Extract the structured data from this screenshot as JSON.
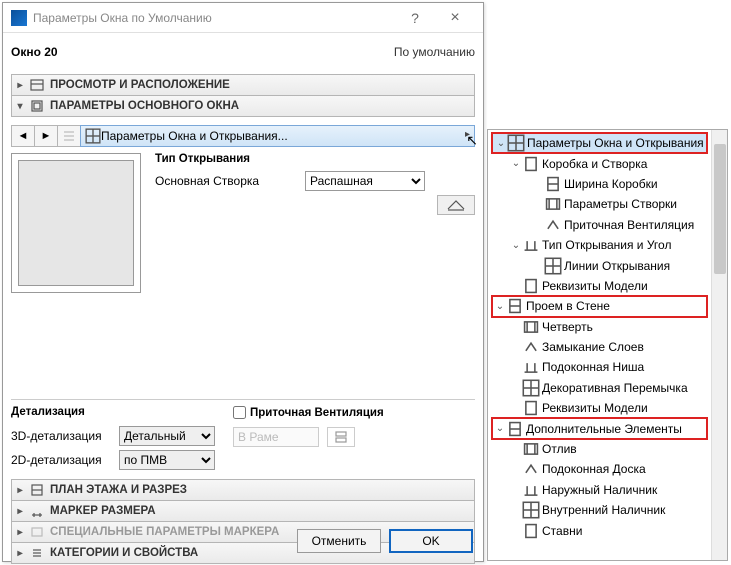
{
  "titlebar": {
    "title": "Параметры Окна по Умолчанию"
  },
  "subheader": {
    "left": "Окно 20",
    "right": "По умолчанию"
  },
  "top_panels": [
    {
      "label": "ПРОСМОТР И РАСПОЛОЖЕНИЕ",
      "expanded": false
    },
    {
      "label": "ПАРАМЕТРЫ ОСНОВНОГО ОКНА",
      "expanded": true
    }
  ],
  "dropdown": {
    "label": "Параметры Окна и Открывания..."
  },
  "opening": {
    "heading": "Тип Открывания",
    "row_label": "Основная Створка",
    "value": "Распашная"
  },
  "detail": {
    "heading": "Детализация",
    "row3d_label": "3D-детализация",
    "row3d_value": "Детальный",
    "row2d_label": "2D-детализация",
    "row2d_value": "по ПМВ"
  },
  "vent": {
    "checkbox_label": "Приточная Вентиляция",
    "label": "В Раме"
  },
  "lower_panels": [
    {
      "label": "ПЛАН ЭТАЖА И РАЗРЕЗ",
      "disabled": false
    },
    {
      "label": "МАРКЕР РАЗМЕРА",
      "disabled": false
    },
    {
      "label": "СПЕЦИАЛЬНЫЕ ПАРАМЕТРЫ МАРКЕРА",
      "disabled": true
    },
    {
      "label": "КАТЕГОРИИ И СВОЙСТВА",
      "disabled": false
    }
  ],
  "buttons": {
    "cancel": "Отменить",
    "ok": "OK"
  },
  "tree": [
    {
      "label": "Параметры Окна и Открывания",
      "depth": 0,
      "expanded": true,
      "hl": true,
      "sel": true
    },
    {
      "label": "Коробка и Створка",
      "depth": 1,
      "expanded": true
    },
    {
      "label": "Ширина Коробки",
      "depth": 2
    },
    {
      "label": "Параметры Створки",
      "depth": 2
    },
    {
      "label": "Приточная Вентиляция",
      "depth": 2
    },
    {
      "label": "Тип Открывания и Угол",
      "depth": 1,
      "expanded": true
    },
    {
      "label": "Линии Открывания",
      "depth": 2
    },
    {
      "label": "Реквизиты Модели",
      "depth": 1
    },
    {
      "label": "Проем в Стене",
      "depth": 0,
      "expanded": true,
      "hl": true
    },
    {
      "label": "Четверть",
      "depth": 1
    },
    {
      "label": "Замыкание Слоев",
      "depth": 1
    },
    {
      "label": "Подоконная Ниша",
      "depth": 1
    },
    {
      "label": "Декоративная Перемычка",
      "depth": 1
    },
    {
      "label": "Реквизиты Модели",
      "depth": 1
    },
    {
      "label": "Дополнительные Элементы",
      "depth": 0,
      "expanded": true,
      "hl": true
    },
    {
      "label": "Отлив",
      "depth": 1
    },
    {
      "label": "Подоконная Доска",
      "depth": 1
    },
    {
      "label": "Наружный Наличник",
      "depth": 1
    },
    {
      "label": "Внутренний Наличник",
      "depth": 1
    },
    {
      "label": "Ставни",
      "depth": 1
    }
  ]
}
